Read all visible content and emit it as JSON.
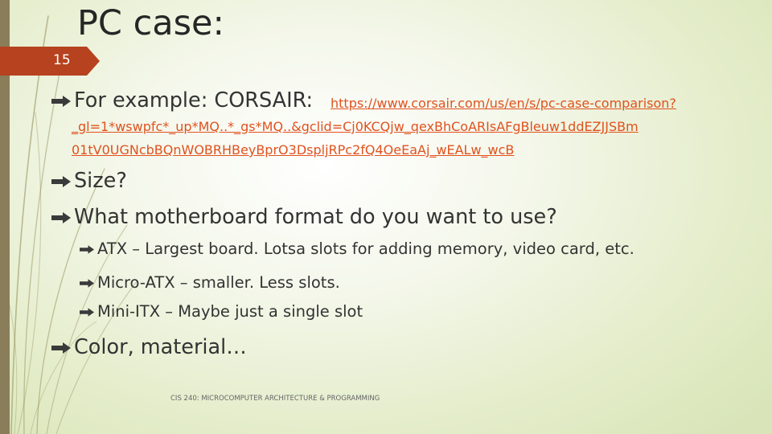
{
  "slide": {
    "title": "PC case:",
    "page_number": "15",
    "footer": "CIS 240: MICROCOMPUTER ARCHITECTURE & PROGRAMMING",
    "accent_color": "#b6421f",
    "link_color": "#e0521e"
  },
  "bullets": {
    "example_label": "For example: CORSAIR:",
    "example_link_lines": [
      "https://www.corsair.com/us/en/s/pc-case-comparison?",
      "_gl=1*wswpfc*_up*MQ..*_gs*MQ..&gclid=Cj0KCQjw_qexBhCoARIsAFgBleuw1ddEZJJSBm",
      "01tV0UGNcbBQnWOBRHBeyBprO3DspljRPc2fQ4OeEaAj_wEALw_wcB"
    ],
    "size": "Size?",
    "motherboard": "What motherboard format do you want to use?",
    "sub_items": [
      "ATX – Largest board. Lotsa slots for adding memory, video card, etc.",
      "Micro-ATX – smaller. Less slots.",
      "Mini-ITX – Maybe just a single slot"
    ],
    "color": "Color, material…"
  },
  "icons": {
    "bullet": "arrow-bullet-icon",
    "deco": "grass-stem-decoration"
  }
}
